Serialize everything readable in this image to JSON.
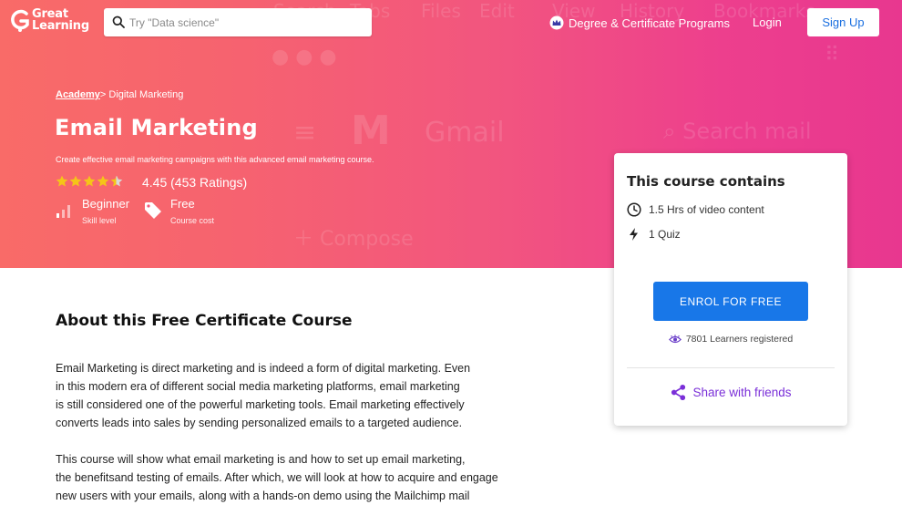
{
  "logo": {
    "line1": "Great",
    "line2": "Learning"
  },
  "search": {
    "placeholder": "Try \"Data science\""
  },
  "nav": {
    "degree_label": "Degree & Certificate Programs",
    "login_label": "Login",
    "signup_label": "Sign Up"
  },
  "background_window": {
    "menu": [
      "Search",
      "Tabs",
      "Files",
      "Edit",
      "View",
      "History",
      "Bookmarks"
    ],
    "gmail_label": "Gmail",
    "search_mail": "Search mail",
    "compose": "Compose"
  },
  "breadcrumb": {
    "parent": "Academy",
    "separator": ">",
    "current": "Digital Marketing"
  },
  "course": {
    "title": "Email Marketing",
    "subtitle": "Create effective email marketing campaigns with this advanced email marketing course.",
    "rating": 4.45,
    "rating_text": "4.45 (453 Ratings)",
    "level_value": "Beginner",
    "level_label": "Skill level",
    "cost_value": "Free",
    "cost_label": "Course cost"
  },
  "card": {
    "title": "This course contains",
    "items": [
      {
        "icon": "clock-icon",
        "label": "1.5 Hrs of video content"
      },
      {
        "icon": "lightning-icon",
        "label": "1 Quiz"
      }
    ],
    "enrol_label": "ENROL FOR FREE",
    "learners": "7801 Learners registered",
    "share_label": "Share with friends"
  },
  "about": {
    "title": "About this Free Certificate Course",
    "para1": [
      "Email Marketing is direct marketing and is indeed a form of digital marketing. Even",
      "in this modern era of different social media marketing platforms, email marketing",
      "is still considered one of the powerful marketing tools. Email marketing effectively",
      "converts leads into sales by sending personalized emails to a targeted audience."
    ],
    "para2": [
      "This course will show what email marketing is and how to set up email marketing,",
      "the benefitsand testing of emails. After which, we will look at how to acquire and engage",
      "new users with your emails, along with a hands-on demo using the Mailchimp mail"
    ]
  },
  "colors": {
    "accent_blue": "#1877e8",
    "share_purple": "#7a2fd8",
    "star": "#f5c518"
  }
}
